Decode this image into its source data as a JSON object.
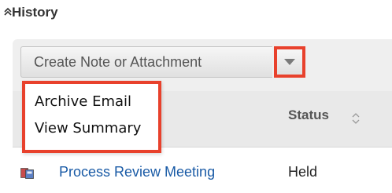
{
  "panel": {
    "title": "History",
    "collapse_icon": "double-chevron-up-icon"
  },
  "toolbar": {
    "create_label": "Create Note or Attachment",
    "dropdown_icon": "caret-down-icon",
    "highlight_color": "#e8412c"
  },
  "dropdown_menu": {
    "items": [
      {
        "label": "Archive Email"
      },
      {
        "label": "View Summary"
      }
    ]
  },
  "table": {
    "columns": [
      {
        "label": "Status",
        "sort_icon": "sort-arrows-icon"
      }
    ],
    "rows": [
      {
        "icon": "meeting-icon",
        "subject": "Process Review Meeting",
        "status": "Held"
      }
    ]
  },
  "colors": {
    "link": "#1a5ba6",
    "panel_bg": "#efefef",
    "highlight": "#e8412c"
  }
}
